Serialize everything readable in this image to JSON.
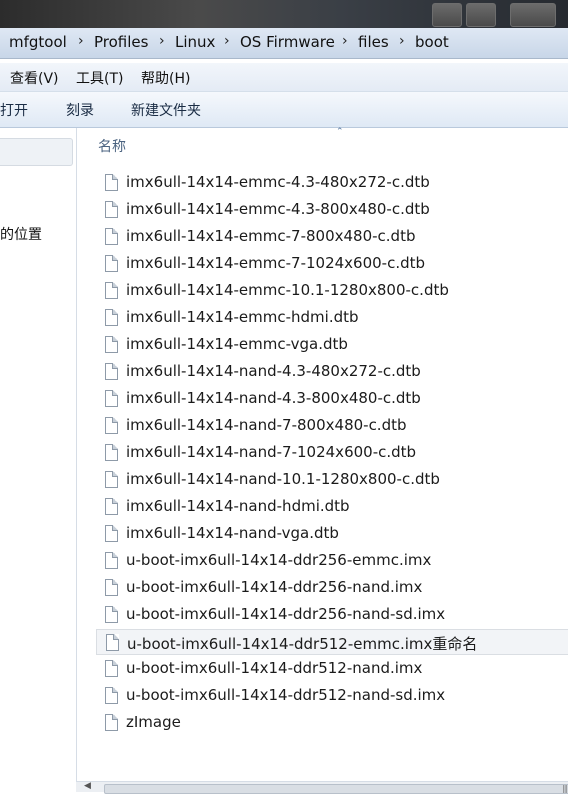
{
  "address_bar": {
    "breadcrumbs": [
      "mfgtool",
      "Profiles",
      "Linux",
      "OS Firmware",
      "files",
      "boot"
    ],
    "separator": "›"
  },
  "menu_bar": {
    "items": [
      "查看(V)",
      "工具(T)",
      "帮助(H)"
    ]
  },
  "toolbar": {
    "items": [
      "打开",
      "刻录",
      "新建文件夹"
    ]
  },
  "nav_pane": {
    "partial_item": "的位置"
  },
  "file_list": {
    "column_header": "名称",
    "sort_indicator": "⌃",
    "files": [
      "imx6ull-14x14-emmc-4.3-480x272-c.dtb",
      "imx6ull-14x14-emmc-4.3-800x480-c.dtb",
      "imx6ull-14x14-emmc-7-800x480-c.dtb",
      "imx6ull-14x14-emmc-7-1024x600-c.dtb",
      "imx6ull-14x14-emmc-10.1-1280x800-c.dtb",
      "imx6ull-14x14-emmc-hdmi.dtb",
      "imx6ull-14x14-emmc-vga.dtb",
      "imx6ull-14x14-nand-4.3-480x272-c.dtb",
      "imx6ull-14x14-nand-4.3-800x480-c.dtb",
      "imx6ull-14x14-nand-7-800x480-c.dtb",
      "imx6ull-14x14-nand-7-1024x600-c.dtb",
      "imx6ull-14x14-nand-10.1-1280x800-c.dtb",
      "imx6ull-14x14-nand-hdmi.dtb",
      "imx6ull-14x14-nand-vga.dtb",
      "u-boot-imx6ull-14x14-ddr256-emmc.imx",
      "u-boot-imx6ull-14x14-ddr256-nand.imx",
      "u-boot-imx6ull-14x14-ddr256-nand-sd.imx",
      "u-boot-imx6ull-14x14-ddr512-emmc.imx重命名",
      "u-boot-imx6ull-14x14-ddr512-nand.imx",
      "u-boot-imx6ull-14x14-ddr512-nand-sd.imx",
      "zImage"
    ],
    "selected_index": 17
  },
  "icons": {
    "file": "file-icon",
    "back": "back-icon",
    "refresh": "refresh-icon"
  }
}
